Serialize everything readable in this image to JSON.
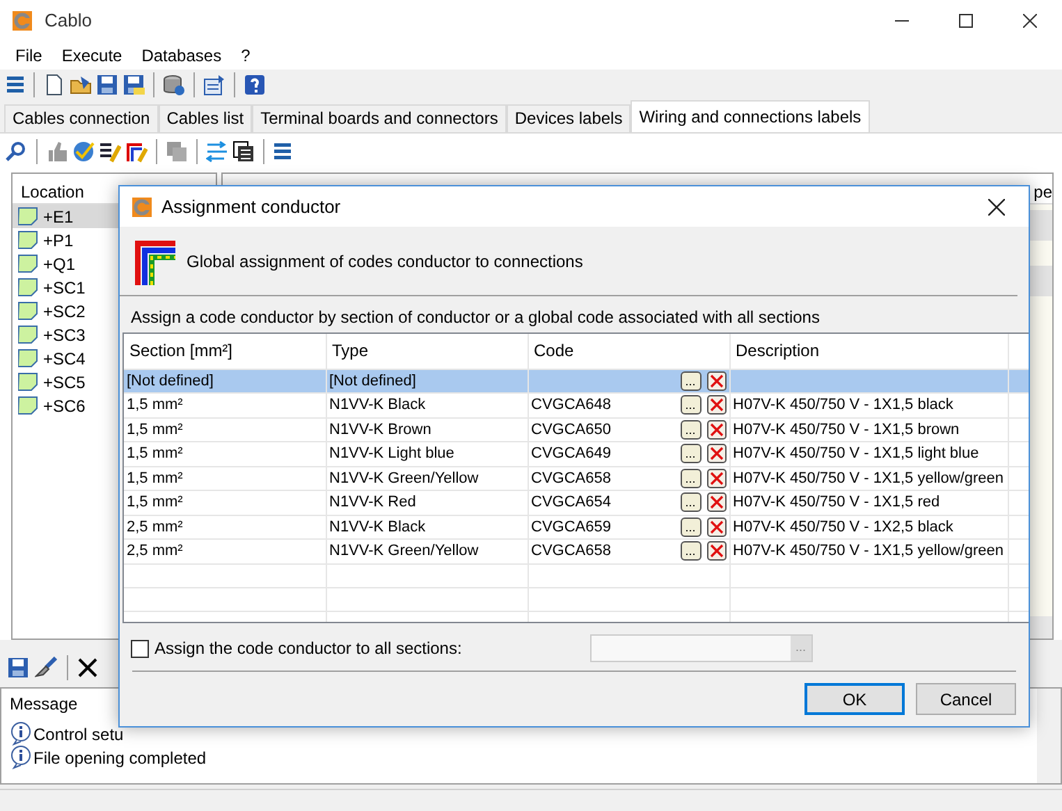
{
  "window": {
    "title": "Cablo"
  },
  "menu": [
    "File",
    "Execute",
    "Databases",
    "?"
  ],
  "tabs": [
    {
      "label": "Cables connection",
      "selected": false
    },
    {
      "label": "Cables list",
      "selected": false
    },
    {
      "label": "Terminal boards and connectors",
      "selected": false
    },
    {
      "label": "Devices labels",
      "selected": false
    },
    {
      "label": "Wiring and connections labels",
      "selected": true
    }
  ],
  "locations": {
    "header": "Location",
    "items": [
      {
        "label": "+E1",
        "selected": true
      },
      {
        "label": "+P1",
        "selected": false
      },
      {
        "label": "+Q1",
        "selected": false
      },
      {
        "label": "+SC1",
        "selected": false
      },
      {
        "label": "+SC2",
        "selected": false
      },
      {
        "label": "+SC3",
        "selected": false
      },
      {
        "label": "+SC4",
        "selected": false
      },
      {
        "label": "+SC5",
        "selected": false
      },
      {
        "label": "+SC6",
        "selected": false
      }
    ]
  },
  "right_panel": {
    "header_fragment": "pe"
  },
  "messages": {
    "header": "Message",
    "items": [
      "Control setu",
      "File opening completed"
    ]
  },
  "dialog": {
    "title": "Assignment conductor",
    "heading": "Global assignment of codes conductor to connections",
    "instruction": "Assign a code conductor by section of conductor or a global code associated with all sections",
    "columns": [
      "Section [mm²]",
      "Type",
      "Code",
      "Description"
    ],
    "rows": [
      {
        "section": "[Not defined]",
        "type": "[Not defined]",
        "code": "",
        "browse": "...",
        "description": "",
        "selected": true
      },
      {
        "section": "1,5 mm²",
        "type": "N1VV-K Black",
        "code": "CVGCA648",
        "browse": "...",
        "description": "H07V-K 450/750 V - 1X1,5 black",
        "selected": false
      },
      {
        "section": "1,5 mm²",
        "type": "N1VV-K Brown",
        "code": "CVGCA650",
        "browse": "...",
        "description": "H07V-K 450/750 V - 1X1,5 brown",
        "selected": false
      },
      {
        "section": "1,5 mm²",
        "type": "N1VV-K Light blue",
        "code": "CVGCA649",
        "browse": "...",
        "description": "H07V-K 450/750 V - 1X1,5 light blue",
        "selected": false
      },
      {
        "section": "1,5 mm²",
        "type": "N1VV-K Green/Yellow",
        "code": "CVGCA658",
        "browse": "...",
        "description": "H07V-K 450/750 V - 1X1,5 yellow/green",
        "selected": false
      },
      {
        "section": "1,5 mm²",
        "type": "N1VV-K Red",
        "code": "CVGCA654",
        "browse": "...",
        "description": "H07V-K 450/750 V - 1X1,5 red",
        "selected": false
      },
      {
        "section": "2,5 mm²",
        "type": "N1VV-K Black",
        "code": "CVGCA659",
        "browse": "...",
        "description": "H07V-K 450/750 V - 1X2,5 black",
        "selected": false
      },
      {
        "section": "2,5 mm²",
        "type": "N1VV-K Green/Yellow",
        "code": "CVGCA658",
        "browse": "...",
        "description": "H07V-K 450/750 V - 1X1,5 yellow/green",
        "selected": false
      }
    ],
    "assign_all": {
      "label": "Assign the code conductor to all sections:",
      "checked": false,
      "browse": "..."
    },
    "buttons": [
      {
        "label": "OK",
        "default": true
      },
      {
        "label": "Cancel",
        "default": false
      }
    ]
  }
}
